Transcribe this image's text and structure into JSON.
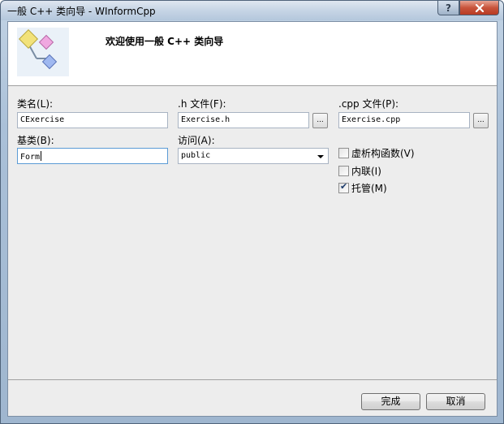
{
  "window": {
    "title": "一般 C++ 类向导 - WInformCpp",
    "help_label": "?",
    "close_label": "x"
  },
  "banner": {
    "title": "欢迎使用一般 C++ 类向导",
    "icon": "class-wizard-icon"
  },
  "form": {
    "class_name": {
      "label": "类名(L):",
      "value": "CExercise"
    },
    "h_file": {
      "label": ".h 文件(F):",
      "value": "Exercise.h",
      "browse_label": "..."
    },
    "cpp_file": {
      "label": ".cpp 文件(P):",
      "value": "Exercise.cpp",
      "browse_label": "..."
    },
    "base_class": {
      "label": "基类(B):",
      "value": "Form"
    },
    "access": {
      "label": "访问(A):",
      "value": "public"
    },
    "options": [
      {
        "label": "虚析构函数(V)",
        "checked": false
      },
      {
        "label": "内联(I)",
        "checked": false
      },
      {
        "label": "托管(M)",
        "checked": true
      }
    ]
  },
  "buttons": {
    "finish": "完成",
    "cancel": "取消"
  }
}
